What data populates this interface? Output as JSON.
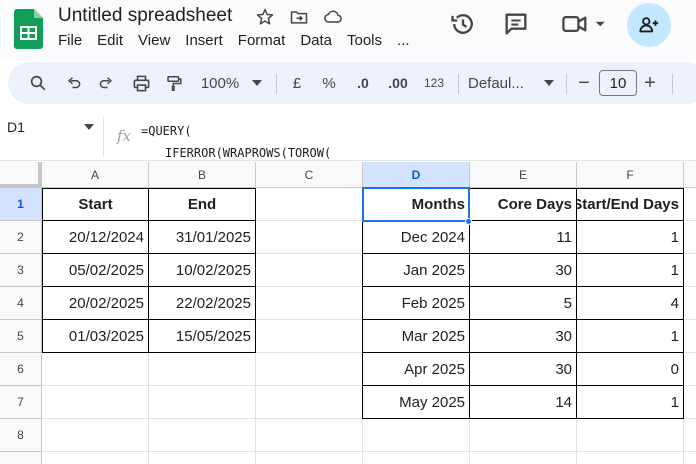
{
  "app": {
    "title": "Untitled spreadsheet",
    "menu": [
      "File",
      "Edit",
      "View",
      "Insert",
      "Format",
      "Data",
      "Tools",
      "..."
    ],
    "icons": [
      "sheets-logo",
      "star-icon",
      "move-folder-icon",
      "cloud-status-icon",
      "history-icon",
      "comments-icon",
      "meet-icon",
      "share-add-person-icon"
    ]
  },
  "toolbar": {
    "zoom": "100%",
    "currency": "£",
    "percent": "%",
    "decrease_decimal": ".0",
    "increase_decimal": ".00",
    "number_format": "123",
    "font": "Defaul...",
    "font_size": "10",
    "minus": "−",
    "plus": "+"
  },
  "formula_bar": {
    "name_box": "D1",
    "fx": "fx",
    "formula_line1": "=QUERY(",
    "formula_line2": "IFERROR(WRAPROWS(TOROW("
  },
  "grid": {
    "columns": [
      "A",
      "B",
      "C",
      "D",
      "E",
      "F"
    ],
    "rows": [
      "1",
      "2",
      "3",
      "4",
      "5",
      "6",
      "7",
      "8"
    ],
    "table1": {
      "headers": [
        "Start",
        "End"
      ],
      "rows": [
        [
          "20/12/2024",
          "31/01/2025"
        ],
        [
          "05/02/2025",
          "10/02/2025"
        ],
        [
          "20/02/2025",
          "22/02/2025"
        ],
        [
          "01/03/2025",
          "15/05/2025"
        ]
      ]
    },
    "table2": {
      "headers": [
        "Months",
        "Core Days",
        "Start/End Days"
      ],
      "rows": [
        [
          "Dec 2024",
          "11",
          "1"
        ],
        [
          "Jan 2025",
          "30",
          "1"
        ],
        [
          "Feb 2025",
          "5",
          "4"
        ],
        [
          "Mar 2025",
          "30",
          "1"
        ],
        [
          "Apr 2025",
          "30",
          "0"
        ],
        [
          "May 2025",
          "14",
          "1"
        ]
      ]
    },
    "selected_cell": "D1",
    "selection_color": "#1a73e8"
  }
}
